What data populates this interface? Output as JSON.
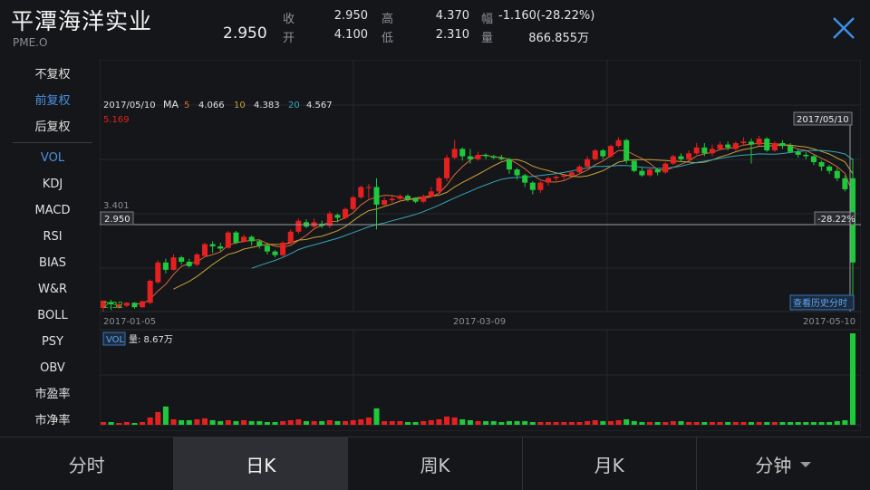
{
  "header": {
    "title": "平潭海洋实业",
    "code": "PME.O",
    "price": "2.950",
    "quotes": [
      {
        "label": "收",
        "value": "2.950"
      },
      {
        "label": "开",
        "value": "4.100"
      },
      {
        "label": "高",
        "value": "4.370"
      },
      {
        "label": "低",
        "value": "2.310"
      },
      {
        "label": "幅",
        "value": "-1.160(-28.22%)"
      },
      {
        "label": "量",
        "value": "866.855万"
      }
    ]
  },
  "side": {
    "items": [
      "不复权",
      "前复权",
      "后复权",
      "VOL",
      "KDJ",
      "MACD",
      "RSI",
      "BIAS",
      "W&R",
      "BOLL",
      "PSY",
      "OBV",
      "市盈率",
      "市净率"
    ],
    "active": [
      "前复权",
      "VOL"
    ]
  },
  "legend": {
    "date": "2017/05/10",
    "ma_label": "MA",
    "ma5_label": "5",
    "ma5_value": "4.066",
    "ma10_label": "10",
    "ma10_value": "4.383",
    "ma20_label": "20",
    "ma20_value": "4.567"
  },
  "chart_data": {
    "type": "candlestick",
    "cursor_date": "2017/05/10",
    "max_label": "5.169",
    "axis_mid_label": "3.401",
    "current_price_label": "2.950",
    "current_pct_label": "-28.22%",
    "low_label": "2.32",
    "x_labels": [
      "2017-01-05",
      "2017-03-09",
      "2017-05-10"
    ],
    "history_button": "查看历史分时",
    "vol_label": "VOL",
    "vol_text": "量: 8.67万",
    "colors": {
      "up": "#e62020",
      "down": "#1ec93c",
      "ma5": "#d46a3c",
      "ma10": "#c8a03c",
      "ma20": "#35a6b8"
    },
    "candles": [
      [
        2.33,
        2.43,
        2.28,
        2.41
      ],
      [
        2.41,
        2.38,
        2.3,
        2.44
      ],
      [
        2.33,
        2.38,
        2.32,
        2.4
      ],
      [
        2.36,
        2.4,
        2.34,
        2.41
      ],
      [
        2.4,
        2.34,
        2.32,
        2.41
      ],
      [
        2.34,
        2.42,
        2.33,
        2.43
      ],
      [
        2.4,
        2.7,
        2.38,
        2.72
      ],
      [
        2.68,
        2.95,
        2.66,
        2.98
      ],
      [
        2.95,
        2.85,
        2.8,
        3.0
      ],
      [
        2.85,
        3.02,
        2.84,
        3.06
      ],
      [
        3.02,
        2.96,
        2.92,
        3.04
      ],
      [
        2.96,
        2.9,
        2.88,
        3.0
      ],
      [
        2.92,
        3.06,
        2.9,
        3.08
      ],
      [
        3.04,
        3.2,
        3.02,
        3.22
      ],
      [
        3.2,
        3.17,
        3.08,
        3.24
      ],
      [
        3.17,
        3.14,
        3.1,
        3.22
      ],
      [
        3.15,
        3.36,
        3.14,
        3.38
      ],
      [
        3.36,
        3.22,
        3.2,
        3.38
      ],
      [
        3.24,
        3.3,
        3.22,
        3.33
      ],
      [
        3.3,
        3.24,
        3.18,
        3.32
      ],
      [
        3.24,
        3.18,
        3.14,
        3.26
      ],
      [
        3.18,
        3.1,
        3.06,
        3.2
      ],
      [
        3.1,
        3.05,
        3.02,
        3.12
      ],
      [
        3.05,
        3.22,
        3.02,
        3.24
      ],
      [
        3.22,
        3.37,
        3.2,
        3.4
      ],
      [
        3.37,
        3.52,
        3.34,
        3.55
      ],
      [
        3.5,
        3.44,
        3.42,
        3.54
      ],
      [
        3.44,
        3.5,
        3.4,
        3.55
      ],
      [
        3.48,
        3.45,
        3.42,
        3.52
      ],
      [
        3.45,
        3.62,
        3.42,
        3.65
      ],
      [
        3.6,
        3.56,
        3.5,
        3.62
      ],
      [
        3.56,
        3.68,
        3.54,
        3.7
      ],
      [
        3.68,
        3.84,
        3.66,
        3.86
      ],
      [
        3.84,
        3.98,
        3.82,
        4.0
      ],
      [
        3.98,
        3.98,
        3.82,
        4.02
      ],
      [
        3.98,
        3.74,
        3.4,
        4.1
      ],
      [
        3.74,
        3.8,
        3.72,
        3.84
      ],
      [
        3.8,
        3.82,
        3.76,
        3.86
      ],
      [
        3.82,
        3.86,
        3.78,
        3.88
      ],
      [
        3.86,
        3.82,
        3.78,
        3.88
      ],
      [
        3.82,
        3.78,
        3.76,
        3.84
      ],
      [
        3.78,
        3.85,
        3.76,
        3.88
      ],
      [
        3.85,
        3.92,
        3.84,
        3.98
      ],
      [
        3.92,
        4.1,
        3.9,
        4.12
      ],
      [
        4.1,
        4.38,
        4.06,
        4.42
      ],
      [
        4.38,
        4.5,
        4.36,
        4.62
      ],
      [
        4.5,
        4.4,
        4.34,
        4.52
      ],
      [
        4.4,
        4.36,
        4.3,
        4.5
      ],
      [
        4.36,
        4.42,
        4.34,
        4.46
      ],
      [
        4.42,
        4.4,
        4.36,
        4.44
      ],
      [
        4.4,
        4.38,
        4.36,
        4.42
      ],
      [
        4.38,
        4.36,
        4.34,
        4.42
      ],
      [
        4.36,
        4.22,
        4.16,
        4.38
      ],
      [
        4.22,
        4.14,
        4.08,
        4.24
      ],
      [
        4.14,
        4.04,
        3.98,
        4.16
      ],
      [
        4.04,
        3.94,
        3.88,
        4.06
      ],
      [
        3.94,
        4.04,
        3.9,
        4.06
      ],
      [
        4.04,
        4.1,
        4.0,
        4.12
      ],
      [
        4.1,
        4.12,
        4.06,
        4.14
      ],
      [
        4.12,
        4.14,
        4.08,
        4.16
      ],
      [
        4.14,
        4.18,
        4.12,
        4.2
      ],
      [
        4.18,
        4.26,
        4.16,
        4.28
      ],
      [
        4.26,
        4.36,
        4.24,
        4.4
      ],
      [
        4.36,
        4.48,
        4.34,
        4.5
      ],
      [
        4.48,
        4.4,
        4.36,
        4.5
      ],
      [
        4.4,
        4.54,
        4.38,
        4.56
      ],
      [
        4.54,
        4.62,
        4.52,
        4.66
      ],
      [
        4.62,
        4.34,
        4.3,
        4.64
      ],
      [
        4.34,
        4.2,
        4.18,
        4.36
      ],
      [
        4.2,
        4.14,
        4.12,
        4.24
      ],
      [
        4.14,
        4.22,
        4.12,
        4.24
      ],
      [
        4.22,
        4.18,
        4.14,
        4.24
      ],
      [
        4.18,
        4.3,
        4.16,
        4.32
      ],
      [
        4.3,
        4.4,
        4.28,
        4.42
      ],
      [
        4.4,
        4.36,
        4.32,
        4.44
      ],
      [
        4.36,
        4.44,
        4.34,
        4.48
      ],
      [
        4.44,
        4.52,
        4.42,
        4.58
      ],
      [
        4.52,
        4.44,
        4.4,
        4.58
      ],
      [
        4.44,
        4.5,
        4.4,
        4.56
      ],
      [
        4.5,
        4.56,
        4.48,
        4.6
      ],
      [
        4.56,
        4.52,
        4.48,
        4.6
      ],
      [
        4.5,
        4.58,
        4.48,
        4.6
      ],
      [
        4.58,
        4.6,
        4.56,
        4.66
      ],
      [
        4.6,
        4.56,
        4.3,
        4.64
      ],
      [
        4.56,
        4.64,
        4.54,
        4.68
      ],
      [
        4.64,
        4.48,
        4.46,
        4.66
      ],
      [
        4.48,
        4.58,
        4.46,
        4.6
      ],
      [
        4.58,
        4.54,
        4.5,
        4.62
      ],
      [
        4.54,
        4.46,
        4.44,
        4.58
      ],
      [
        4.46,
        4.42,
        4.38,
        4.5
      ],
      [
        4.42,
        4.4,
        4.36,
        4.46
      ],
      [
        4.4,
        4.32,
        4.28,
        4.42
      ],
      [
        4.32,
        4.26,
        4.2,
        4.34
      ],
      [
        4.26,
        4.2,
        4.16,
        4.28
      ],
      [
        4.2,
        4.1,
        4.06,
        4.24
      ],
      [
        4.1,
        3.95,
        3.92,
        4.14
      ],
      [
        4.1,
        2.95,
        2.31,
        4.37
      ]
    ],
    "volumes": [
      3,
      3,
      2,
      3,
      2,
      3,
      8,
      14,
      20,
      6,
      5,
      5,
      6,
      7,
      5,
      4,
      5,
      4,
      5,
      4,
      4,
      3,
      3,
      4,
      5,
      6,
      4,
      4,
      4,
      5,
      4,
      4,
      5,
      6,
      8,
      18,
      4,
      4,
      4,
      3,
      3,
      4,
      5,
      6,
      9,
      8,
      6,
      5,
      4,
      4,
      4,
      3,
      4,
      4,
      4,
      3,
      3,
      3,
      3,
      3,
      3,
      3,
      4,
      5,
      4,
      4,
      5,
      6,
      4,
      3,
      3,
      3,
      3,
      4,
      4,
      3,
      3,
      3,
      3,
      3,
      3,
      3,
      3,
      3,
      3,
      3,
      3,
      3,
      3,
      3,
      3,
      3,
      3,
      3,
      4,
      5,
      100
    ]
  },
  "tabs": {
    "items": [
      "分时",
      "日K",
      "周K",
      "月K",
      "分钟"
    ],
    "active": "日K"
  }
}
